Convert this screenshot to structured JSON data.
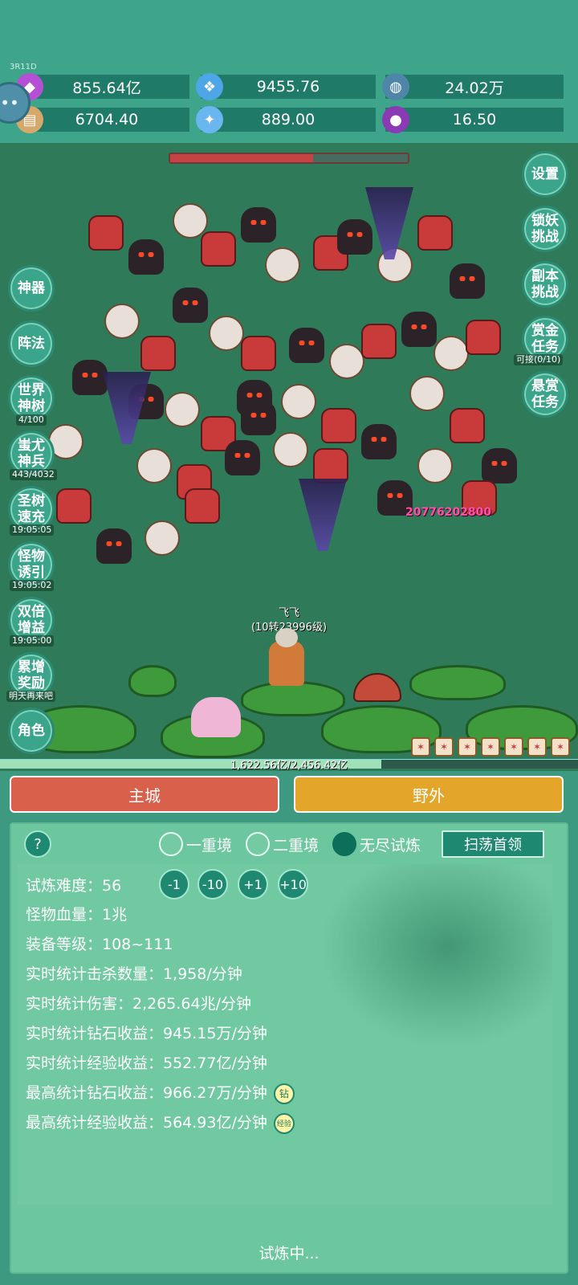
{
  "top": {
    "tiny_label": "3R11D",
    "resources": [
      {
        "id": "diamond",
        "value": "855.64亿",
        "icon": "purple-gem-icon",
        "color": "#b44fd6"
      },
      {
        "id": "crystal",
        "value": "9455.76",
        "icon": "blue-crystal-icon",
        "color": "#4fa6e6"
      },
      {
        "id": "planet",
        "value": "24.02万",
        "icon": "planet-icon",
        "color": "#4f86a8"
      },
      {
        "id": "scroll",
        "value": "6704.40",
        "icon": "scroll-icon",
        "color": "#d6a86a"
      },
      {
        "id": "shard",
        "value": "889.00",
        "icon": "ice-shard-icon",
        "color": "#6ab6f0"
      },
      {
        "id": "orb",
        "value": "16.50",
        "icon": "purple-orb-icon",
        "color": "#8a3ab4"
      }
    ]
  },
  "battle": {
    "boss_hp_fraction": 0.6,
    "damage_popup": "20776202800",
    "hero_name": "飞飞",
    "hero_level": "(10转23996级)",
    "exp_text": "1,622.56亿/2,456.42亿",
    "exp_fraction": 0.66,
    "left_buttons": [
      {
        "label": "神器",
        "sub": ""
      },
      {
        "label": "阵法",
        "sub": ""
      },
      {
        "label": "世界神树",
        "sub": "4/100"
      },
      {
        "label": "蚩尤神兵",
        "sub": "443/4032"
      },
      {
        "label": "圣树速充",
        "sub": "19:05:05"
      },
      {
        "label": "怪物诱引",
        "sub": "19:05:02"
      },
      {
        "label": "双倍增益",
        "sub": "19:05:00"
      },
      {
        "label": "累增奖励",
        "sub": "明天再来吧"
      },
      {
        "label": "角色",
        "sub": ""
      }
    ],
    "right_buttons": [
      {
        "label": "设置",
        "sub": ""
      },
      {
        "label": "锁妖挑战",
        "sub": ""
      },
      {
        "label": "副本挑战",
        "sub": ""
      },
      {
        "label": "赏金任务",
        "sub": "可接(0/10)"
      },
      {
        "label": "悬赏任务",
        "sub": ""
      }
    ]
  },
  "nav": {
    "city": "主城",
    "field": "野外"
  },
  "trial": {
    "help": "?",
    "modes": [
      "一重境",
      "二重境",
      "无尽试炼"
    ],
    "sweep_label": "扫荡首领",
    "difficulty_label": "试炼难度：",
    "difficulty_value": "56",
    "adjust": [
      "-1",
      "-10",
      "+1",
      "+10"
    ],
    "stats": [
      "怪物血量：1兆",
      "装备等级：108~111",
      "实时统计击杀数量：1,958/分钟",
      "实时统计伤害：2,265.64兆/分钟",
      "实时统计钻石收益：945.15万/分钟",
      "实时统计经验收益：552.77亿/分钟",
      "最高统计钻石收益：966.27万/分钟",
      "最高统计经验收益：564.93亿/分钟"
    ],
    "tag_diamond": "钻",
    "tag_exp": "经验",
    "status": "试炼中..."
  }
}
